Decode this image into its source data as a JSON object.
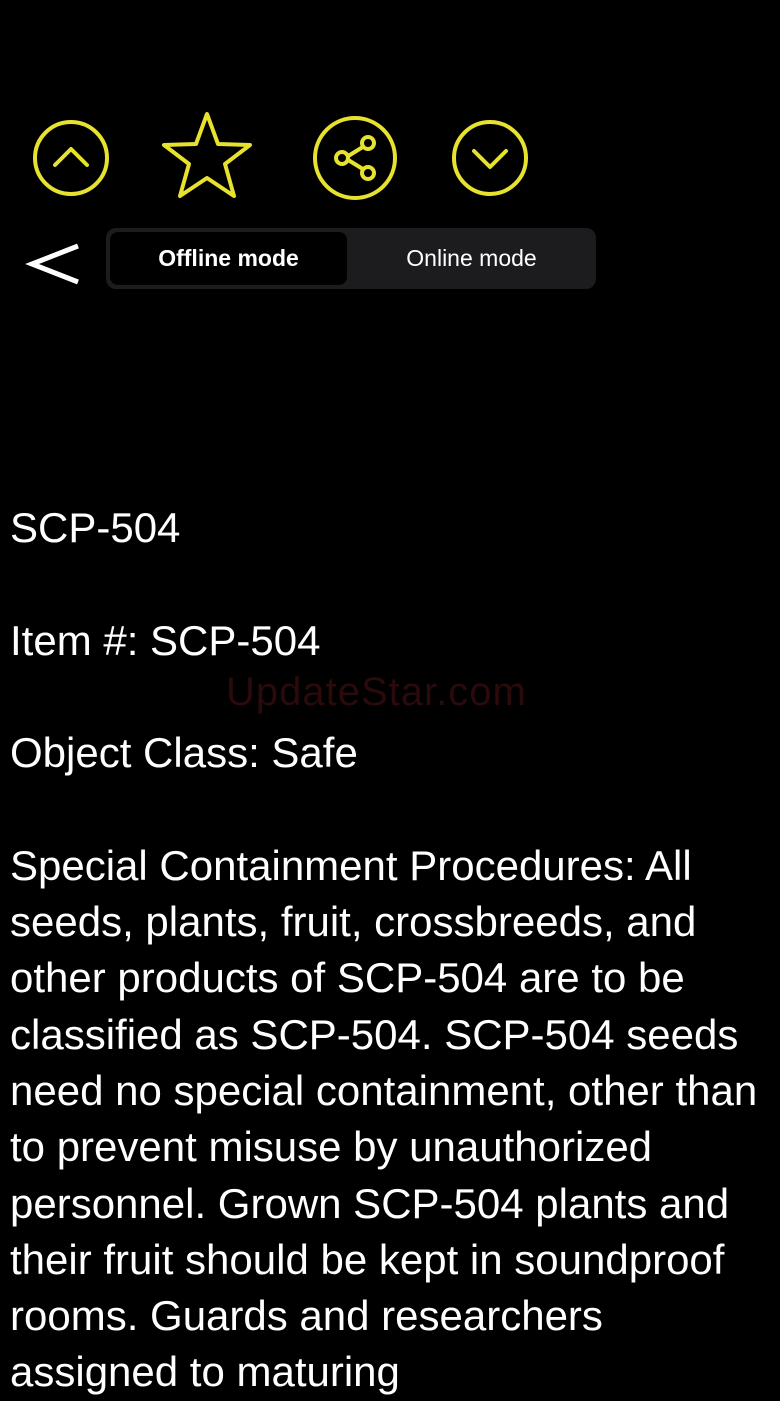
{
  "toolbar": {
    "previous_icon": "chevron-up-circle-icon",
    "favorite_icon": "star-outline-icon",
    "share_icon": "share-circle-icon",
    "next_icon": "chevron-down-circle-icon",
    "accent_color": "#e6e22e"
  },
  "nav": {
    "back_label": "<"
  },
  "mode_switch": {
    "options": [
      "Offline mode",
      "Online mode"
    ],
    "selected": "Offline mode"
  },
  "watermark": "UpdateStar.com",
  "article": {
    "title": "SCP-504",
    "item_number": "Item #:  SCP-504",
    "object_class": "Object Class:  Safe",
    "containment": "Special Containment Procedures:  All seeds, plants, fruit, crossbreeds, and other products of SCP-504 are to be classified as SCP-504. SCP-504 seeds need no special containment, other than to prevent misuse by unauthorized personnel. Grown SCP-504 plants and their fruit should be kept in soundproof rooms. Guards and researchers assigned to maturing"
  }
}
